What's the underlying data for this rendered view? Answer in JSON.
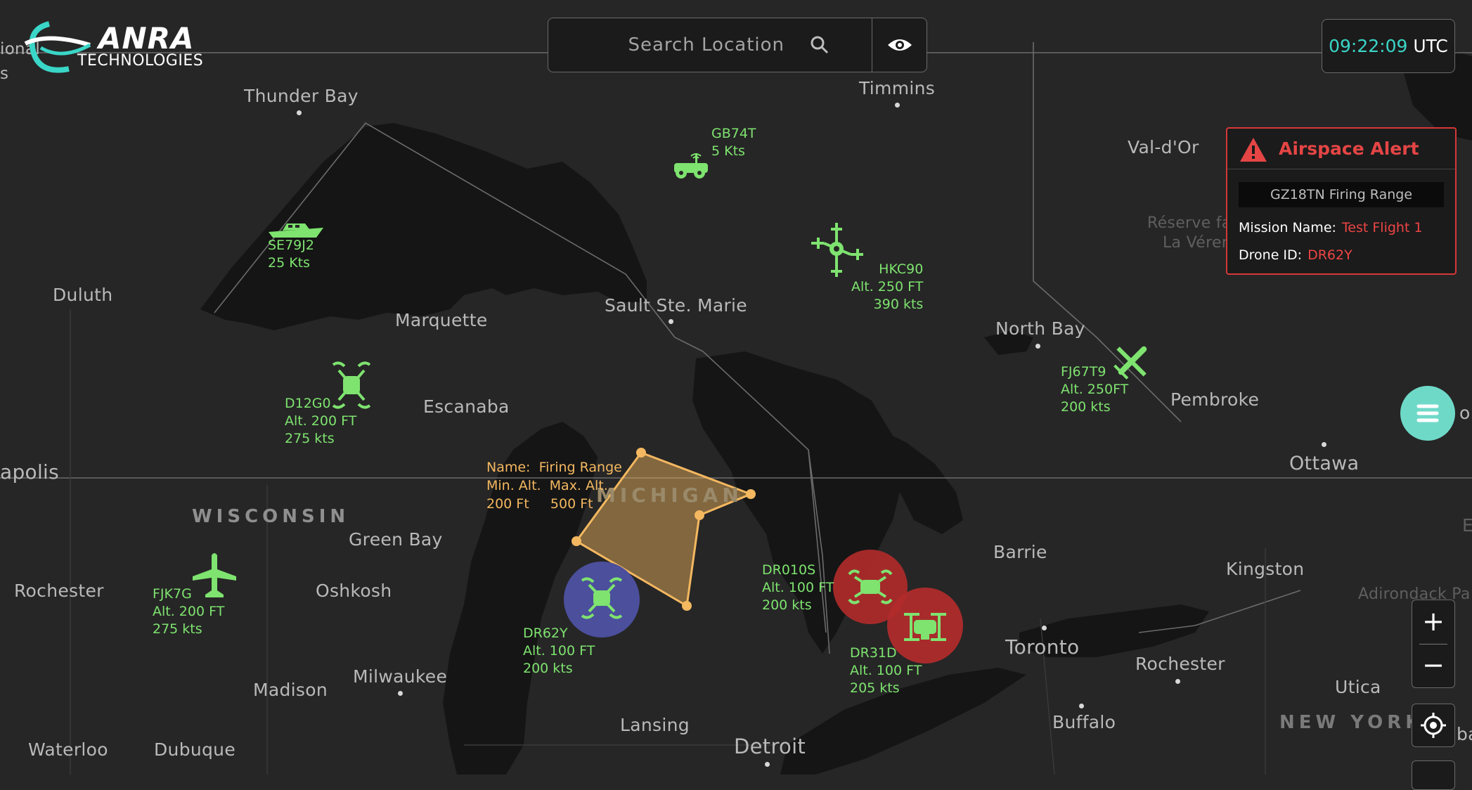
{
  "brand": {
    "name": "ANRA",
    "sub": "TECHNOLOGIES"
  },
  "search": {
    "placeholder": "Search Location"
  },
  "clock": {
    "time": "09:22:09",
    "zone": "UTC"
  },
  "alert": {
    "title": "Airspace Alert",
    "zone": "GZ18TN Firing Range",
    "mission_label": "Mission Name:",
    "mission_value": "Test Flight 1",
    "drone_label": "Drone ID:",
    "drone_value": "DR62Y",
    "color": "#e54545"
  },
  "zone": {
    "name_label": "Name:",
    "name": "Firing Range",
    "min_label": "Min. Alt.",
    "max_label": "Max. Alt.",
    "min_alt": "200 Ft",
    "max_alt": "500 Ft",
    "color": "#f4b860"
  },
  "map": {
    "cities": {
      "thunder_bay": "Thunder Bay",
      "timmins": "Timmins",
      "val_dor": "Val-d'Or",
      "reserve1": "Réserve fa",
      "reserve2": "La Vérer",
      "duluth": "Duluth",
      "marquette": "Marquette",
      "sault": "Sault Ste. Marie",
      "north_bay": "North Bay",
      "escanaba": "Escanaba",
      "pembroke": "Pembroke",
      "apolis": "apolis",
      "ottawa": "Ottawa",
      "green_bay": "Green Bay",
      "barrie": "Barrie",
      "kingston": "Kingston",
      "adirondack": "Adirondack Pa",
      "rochester_w": "Rochester",
      "oshkosh": "Oshkosh",
      "toronto": "Toronto",
      "rochester_e": "Rochester",
      "milwaukee": "Milwaukee",
      "madison": "Madison",
      "utica": "Utica",
      "lansing": "Lansing",
      "buffalo": "Buffalo",
      "waterloo": "Waterloo",
      "dubuque": "Dubuque",
      "detroit": "Detroit",
      "edge_onal": "ional",
      "edge_s": "s",
      "edge_o": "o",
      "edge_e": "E",
      "edge_ba": "ba"
    },
    "regions": {
      "wisconsin": "WISCONSIN",
      "michigan": "MICHIGAN",
      "new_york": "NEW YORK"
    }
  },
  "vehicles": [
    {
      "id": "GB74T",
      "speed": "5 Kts"
    },
    {
      "id": "SE79J2",
      "speed": "25 Kts"
    },
    {
      "id": "HKC90",
      "alt": "Alt. 250 FT",
      "speed": "390 kts"
    },
    {
      "id": "D12G0",
      "alt": "Alt. 200 FT",
      "speed": "275 kts"
    },
    {
      "id": "FJ67T9",
      "alt": "Alt. 250FT",
      "speed": "200 kts"
    },
    {
      "id": "FJK7G",
      "alt": "Alt. 200 FT",
      "speed": "275 kts"
    },
    {
      "id": "DR62Y",
      "alt": "Alt. 100 FT",
      "speed": "200 kts"
    },
    {
      "id": "DR010S",
      "alt": "Alt. 100 FT",
      "speed": "200 kts"
    },
    {
      "id": "DR31D",
      "alt": "Alt. 100 FT",
      "speed": "205 kts"
    }
  ],
  "colors": {
    "vehicle": "#7ee36f",
    "accent": "#3ad6c7",
    "alert_ring": "#b32b2b",
    "selected_ring": "#4b4f9c",
    "map_bg": "#262626",
    "water": "#151515"
  },
  "zoom": {
    "in": "+",
    "out": "−"
  }
}
